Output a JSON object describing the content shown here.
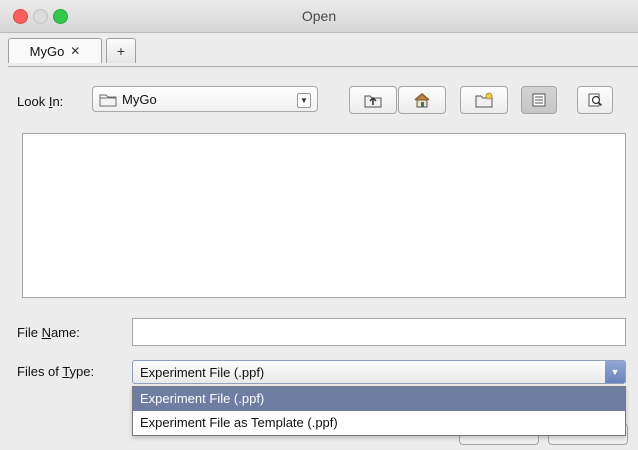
{
  "window": {
    "title": "Open"
  },
  "tabs": [
    {
      "label": "MyGo",
      "close": "✕"
    }
  ],
  "add_tab_label": "+",
  "look_in": {
    "label_prefix": "Look ",
    "label_mnemonic": "I",
    "label_suffix": "n:",
    "value": "MyGo"
  },
  "toolbar": {
    "icons": [
      "up-one-level-icon",
      "home-icon",
      "new-folder-icon",
      "list-view-icon",
      "details-view-icon"
    ]
  },
  "file_name": {
    "label_prefix": "File ",
    "label_mnemonic": "N",
    "label_suffix": "ame:",
    "value": ""
  },
  "files_of_type": {
    "label_prefix": "Files of ",
    "label_mnemonic": "T",
    "label_suffix": "ype:",
    "value": "Experiment File (.ppf)",
    "options": [
      "Experiment File (.ppf)",
      "Experiment File as Template (.ppf)"
    ]
  },
  "colors": {
    "selection": "#6f7da3",
    "close": "#fc605c",
    "maximize": "#34c84a"
  }
}
